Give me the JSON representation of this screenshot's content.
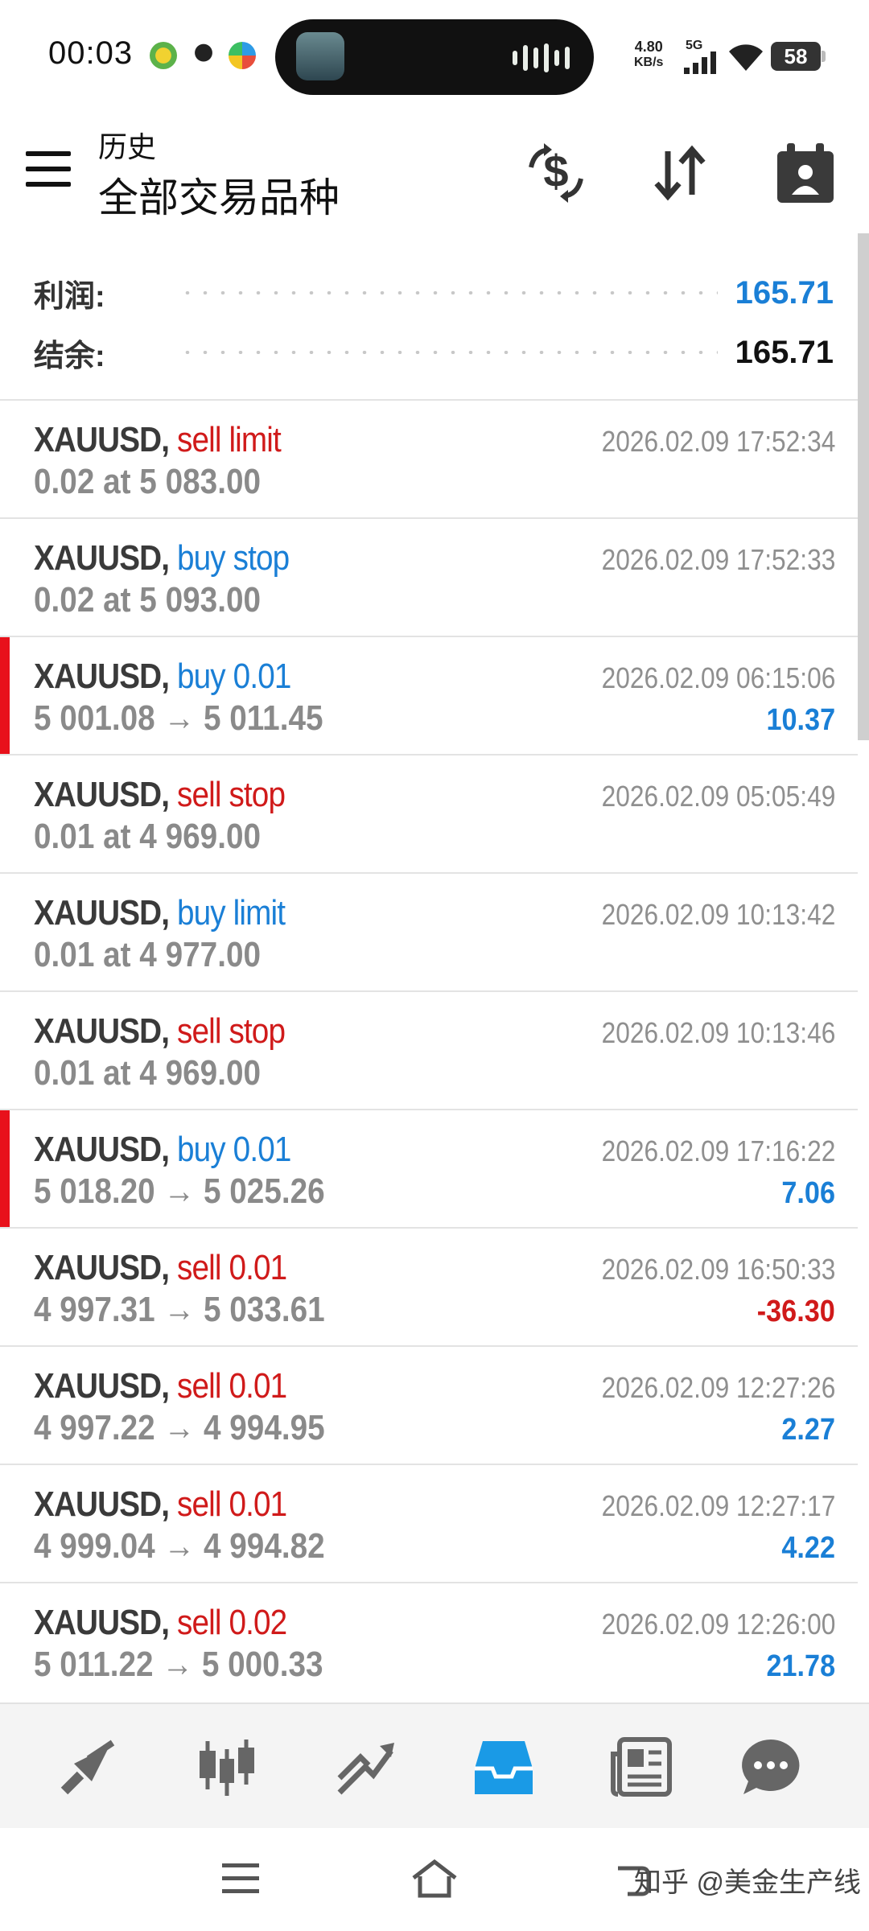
{
  "status_bar": {
    "time": "00:03",
    "net_speed_value": "4.80",
    "net_speed_unit": "KB/s",
    "network": "5G",
    "battery": "58"
  },
  "header": {
    "subtitle": "历史",
    "title": "全部交易品种"
  },
  "summary": {
    "profit_label": "利润:",
    "profit_value": "165.71",
    "balance_label": "结余:",
    "balance_value": "165.71"
  },
  "deals": [
    {
      "symbol": "XAUUSD,",
      "type": "sell limit",
      "type_color": "#d01a1a",
      "detail": "0.02 at 5 083.00",
      "time": "2026.02.09 17:52:34",
      "profit": "",
      "marker": false
    },
    {
      "symbol": "XAUUSD,",
      "type": "buy stop",
      "type_color": "#1a7fd6",
      "detail": "0.02 at 5 093.00",
      "time": "2026.02.09 17:52:33",
      "profit": "",
      "marker": false
    },
    {
      "symbol": "XAUUSD,",
      "type": "buy 0.01",
      "type_color": "#1a7fd6",
      "detail": "5 001.08 → 5 011.45",
      "time": "2026.02.09 06:15:06",
      "profit": "10.37",
      "profit_color": "#1a7fd6",
      "marker": true
    },
    {
      "symbol": "XAUUSD,",
      "type": "sell stop",
      "type_color": "#d01a1a",
      "detail": "0.01 at 4 969.00",
      "time": "2026.02.09 05:05:49",
      "profit": "",
      "marker": false
    },
    {
      "symbol": "XAUUSD,",
      "type": "buy limit",
      "type_color": "#1a7fd6",
      "detail": "0.01 at 4 977.00",
      "time": "2026.02.09 10:13:42",
      "profit": "",
      "marker": false
    },
    {
      "symbol": "XAUUSD,",
      "type": "sell stop",
      "type_color": "#d01a1a",
      "detail": "0.01 at 4 969.00",
      "time": "2026.02.09 10:13:46",
      "profit": "",
      "marker": false
    },
    {
      "symbol": "XAUUSD,",
      "type": "buy 0.01",
      "type_color": "#1a7fd6",
      "detail": "5 018.20 → 5 025.26",
      "time": "2026.02.09 17:16:22",
      "profit": "7.06",
      "profit_color": "#1a7fd6",
      "marker": true
    },
    {
      "symbol": "XAUUSD,",
      "type": "sell 0.01",
      "type_color": "#d01a1a",
      "detail": "4 997.31 → 5 033.61",
      "time": "2026.02.09 16:50:33",
      "profit": "-36.30",
      "profit_color": "#d01a1a",
      "marker": false
    },
    {
      "symbol": "XAUUSD,",
      "type": "sell 0.01",
      "type_color": "#d01a1a",
      "detail": "4 997.22 → 4 994.95",
      "time": "2026.02.09 12:27:26",
      "profit": "2.27",
      "profit_color": "#1a7fd6",
      "marker": false
    },
    {
      "symbol": "XAUUSD,",
      "type": "sell 0.01",
      "type_color": "#d01a1a",
      "detail": "4 999.04 → 4 994.82",
      "time": "2026.02.09 12:27:17",
      "profit": "4.22",
      "profit_color": "#1a7fd6",
      "marker": false
    },
    {
      "symbol": "XAUUSD,",
      "type": "sell 0.02",
      "type_color": "#d01a1a",
      "detail": "5 011.22 → 5 000.33",
      "time": "2026.02.09 12:26:00",
      "profit": "21.78",
      "profit_color": "#1a7fd6",
      "marker": false
    }
  ],
  "tabs": [
    {
      "icon": "quotes-icon",
      "active": false
    },
    {
      "icon": "chart-candles-icon",
      "active": false
    },
    {
      "icon": "trade-icon",
      "active": false
    },
    {
      "icon": "history-inbox-icon",
      "active": true
    },
    {
      "icon": "news-icon",
      "active": false
    },
    {
      "icon": "chat-icon",
      "active": false
    }
  ],
  "colors": {
    "accent": "#1a7fd6",
    "loss": "#d01a1a",
    "marker": "#e8111b"
  },
  "watermark": "知乎 @美金生产线"
}
